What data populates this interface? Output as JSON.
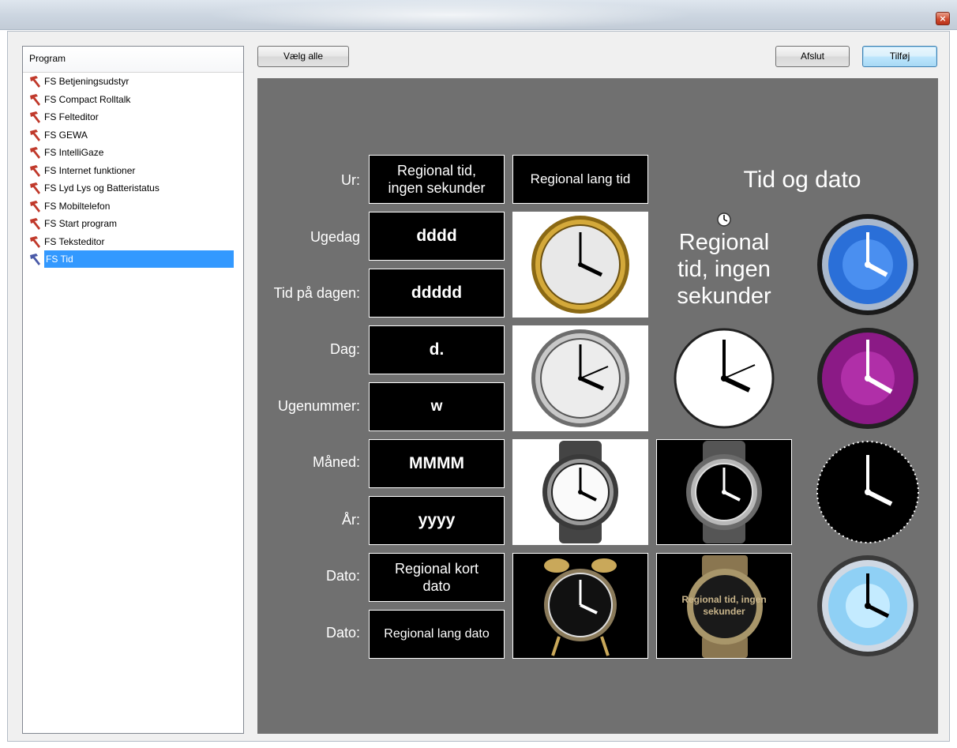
{
  "window": {
    "close_label": "×"
  },
  "program_list": {
    "header": "Program",
    "items": [
      {
        "label": "FS Betjeningsudstyr",
        "selected": false
      },
      {
        "label": "FS Compact Rolltalk",
        "selected": false
      },
      {
        "label": "FS Felteditor",
        "selected": false
      },
      {
        "label": "FS GEWA",
        "selected": false
      },
      {
        "label": "FS IntelliGaze",
        "selected": false
      },
      {
        "label": "FS Internet funktioner",
        "selected": false
      },
      {
        "label": "FS Lyd Lys og Batteristatus",
        "selected": false
      },
      {
        "label": "FS Mobiltelefon",
        "selected": false
      },
      {
        "label": "FS Start program",
        "selected": false
      },
      {
        "label": "FS Teksteditor",
        "selected": false
      },
      {
        "label": "FS Tid",
        "selected": true
      }
    ]
  },
  "toolbar": {
    "select_all_label": "Vælg alle",
    "exit_label": "Afslut",
    "add_label": "Tilføj"
  },
  "grid": {
    "labels": {
      "ur": "Ur:",
      "ugedag": "Ugedag",
      "tid_paa_dagen": "Tid på dagen:",
      "dag": "Dag:",
      "ugenummer": "Ugenummer:",
      "maaned": "Måned:",
      "aar": "År:",
      "dato1": "Dato:",
      "dato2": "Dato:"
    },
    "cells": {
      "regional_tid_line1": "Regional tid,",
      "regional_tid_line2": "ingen sekunder",
      "regional_lang_tid": "Regional lang tid",
      "dddd": "dddd",
      "ddddd": "ddddd",
      "d": "d.",
      "w": "w",
      "mmmm": "MMMM",
      "yyyy": "yyyy",
      "regional_kort_dato_line1": "Regional kort",
      "regional_kort_dato_line2": "dato",
      "regional_lang_dato": "Regional lang dato",
      "watch_overlay_line1": "Regional tid, ingen",
      "watch_overlay_line2": "sekunder"
    },
    "headline": "Tid og dato",
    "big_regional_line1": "Regional",
    "big_regional_line2": "tid, ingen",
    "big_regional_line3": "sekunder"
  },
  "colors": {
    "panel_bg": "#707070",
    "selection": "#3399ff",
    "icon_red": "#c0392b",
    "icon_blue": "#4a5aa8"
  }
}
